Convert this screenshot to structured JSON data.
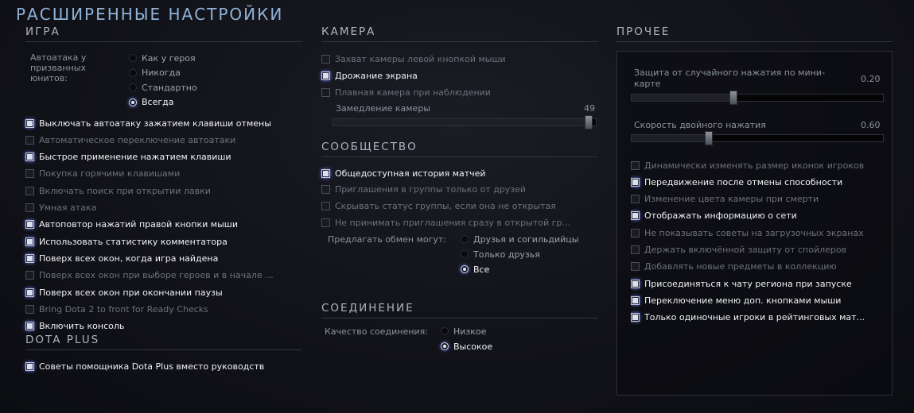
{
  "page_title": "РАСШИРЕННЫЕ НАСТРОЙКИ",
  "game": {
    "title": "ИГРА",
    "autoattack_label": "Автоатака у призванных юнитов:",
    "autoattack_options": [
      "Как у героя",
      "Никогда",
      "Стандартно",
      "Всегда"
    ],
    "autoattack_selected": "Всегда",
    "options": [
      {
        "label": "Выключать автоатаку зажатием клавиши отмены",
        "checked": true
      },
      {
        "label": "Автоматическое переключение автоатаки",
        "checked": false
      },
      {
        "label": "Быстрое применение нажатием клавиши",
        "checked": true
      },
      {
        "label": "Покупка горячими клавишами",
        "checked": false
      },
      {
        "label": "Включать поиск при открытии лавки",
        "checked": false
      },
      {
        "label": "Умная атака",
        "checked": false
      },
      {
        "label": "Автоповтор нажатий правой кнопки мыши",
        "checked": true
      },
      {
        "label": "Использовать статистику комментатора",
        "checked": true
      },
      {
        "label": "Поверх всех окон, когда игра найдена",
        "checked": true
      },
      {
        "label": "Поверх всех окон при выборе героев и в начале ...",
        "checked": false
      },
      {
        "label": "Поверх всех окон при окончании паузы",
        "checked": true
      },
      {
        "label": "Bring Dota 2 to front for Ready Checks",
        "checked": false
      },
      {
        "label": "Включить консоль",
        "checked": true
      }
    ]
  },
  "dota_plus": {
    "title": "DOTA PLUS",
    "options": [
      {
        "label": "Советы помощника Dota Plus вместо руководств",
        "checked": true
      }
    ]
  },
  "camera": {
    "title": "КАМЕРА",
    "options": [
      {
        "label": "Захват камеры левой кнопкой мыши",
        "checked": false
      },
      {
        "label": "Дрожание экрана",
        "checked": true
      },
      {
        "label": "Плавная камера при наблюдении",
        "checked": false
      }
    ],
    "slowdown_label": "Замедление камеры",
    "slowdown_value": "49",
    "slowdown_fraction": 0.98
  },
  "community": {
    "title": "СООБЩЕСТВО",
    "options": [
      {
        "label": "Общедоступная история матчей",
        "checked": true
      },
      {
        "label": "Приглашения в группы только от друзей",
        "checked": false
      },
      {
        "label": "Скрывать статус группы, если она не открытая",
        "checked": false
      },
      {
        "label": "Не принимать приглашения сразу в открытой гр...",
        "checked": false
      }
    ],
    "trade_label": "Предлагать обмен могут:",
    "trade_options": [
      "Друзья и согильдийцы",
      "Только друзья",
      "Все"
    ],
    "trade_selected": "Все"
  },
  "connection": {
    "title": "СОЕДИНЕНИЕ",
    "quality_label": "Качество соединения:",
    "quality_options": [
      "Низкое",
      "Высокое"
    ],
    "quality_selected": "Высокое"
  },
  "other": {
    "title": "ПРОЧЕЕ",
    "minimap_label": "Защита от случайного нажатия по мини-карте",
    "minimap_value": "0.20",
    "minimap_fraction": 0.4,
    "doubleclick_label": "Скорость двойного нажатия",
    "doubleclick_value": "0.60",
    "doubleclick_fraction": 0.3,
    "options": [
      {
        "label": "Динамически изменять размер иконок игроков",
        "checked": false
      },
      {
        "label": "Передвижение после отмены способности",
        "checked": true
      },
      {
        "label": "Изменение цвета камеры при смерти",
        "checked": false
      },
      {
        "label": "Отображать информацию о сети",
        "checked": true
      },
      {
        "label": "Не показывать советы на загрузочных экранах",
        "checked": false
      },
      {
        "label": "Держать включённой защиту от спойлеров",
        "checked": false
      },
      {
        "label": "Добавлять новые предметы в коллекцию",
        "checked": false
      },
      {
        "label": "Присоединяться к чату региона при запуске",
        "checked": true
      },
      {
        "label": "Переключение меню доп. кнопками мыши",
        "checked": true
      },
      {
        "label": "Только одиночные игроки в рейтинговых мат...",
        "checked": true
      }
    ]
  }
}
